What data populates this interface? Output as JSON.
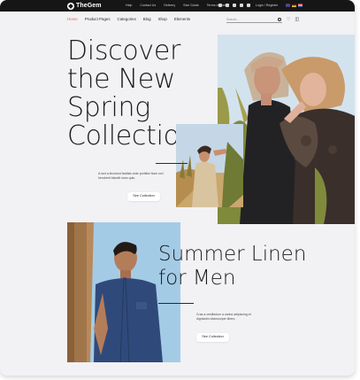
{
  "brand": {
    "name": "TheGem"
  },
  "topbar": {
    "links": [
      "Help",
      "Contact Us",
      "Delivery",
      "Size Guide",
      "Terms of Sale"
    ],
    "login": "Login / Register"
  },
  "nav": {
    "items": [
      "Home",
      "Product Pages",
      "Categories",
      "Blog",
      "Shop",
      "Elements"
    ],
    "active_index": 0
  },
  "search": {
    "placeholder": "Search..."
  },
  "hero": {
    "title_lines": [
      "Discover",
      "the New",
      "Spring",
      "Collection"
    ],
    "description": "A sed a tincidunt facilisis ante porttitor Nam orci hendrerit blandit nunc quis.",
    "button_label": "See Collection"
  },
  "summer": {
    "title_lines": [
      "Summer Linen",
      "for Men"
    ],
    "description": "Cras a vestibulum a varius adipiscing et dignissim ullamcorper libero.",
    "button_label": "See Collection"
  },
  "colors": {
    "accent": "#e4685d",
    "topbar_bg": "#161617",
    "page_bg": "#f2f1f4",
    "text": "#1c1c1f"
  },
  "icons": [
    "logo-icon",
    "instagram-icon",
    "twitter-icon",
    "facebook-icon",
    "youtube-icon",
    "pinterest-icon",
    "flag-uk-icon",
    "flag-de-icon",
    "flag-nl-icon",
    "search-icon",
    "heart-icon",
    "cart-icon"
  ]
}
